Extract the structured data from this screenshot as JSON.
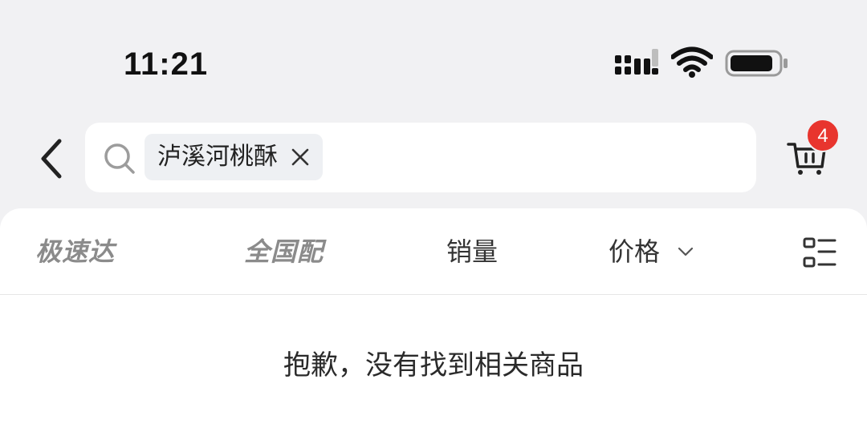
{
  "status_bar": {
    "time": "11:21",
    "icons": [
      "cellular-signal-icon",
      "wifi-icon",
      "battery-icon"
    ]
  },
  "header": {
    "back_icon": "chevron-left-icon",
    "search": {
      "icon": "search-icon",
      "query_chip": "泸溪河桃酥",
      "chip_clear_icon": "close-icon"
    },
    "cart": {
      "icon": "cart-icon",
      "badge_count": "4"
    }
  },
  "sort_bar": {
    "tabs": [
      {
        "label": "极速达"
      },
      {
        "label": "全国配"
      },
      {
        "label": "销量"
      },
      {
        "label": "价格"
      }
    ],
    "price_caret_icon": "chevron-down-icon",
    "layout_toggle_icon": "list-layout-icon"
  },
  "results": {
    "empty_message": "抱歉，没有找到相关商品"
  },
  "colors": {
    "background": "#f1f1f3",
    "badge": "#e8352e",
    "muted_tab": "#8b8b8b"
  }
}
